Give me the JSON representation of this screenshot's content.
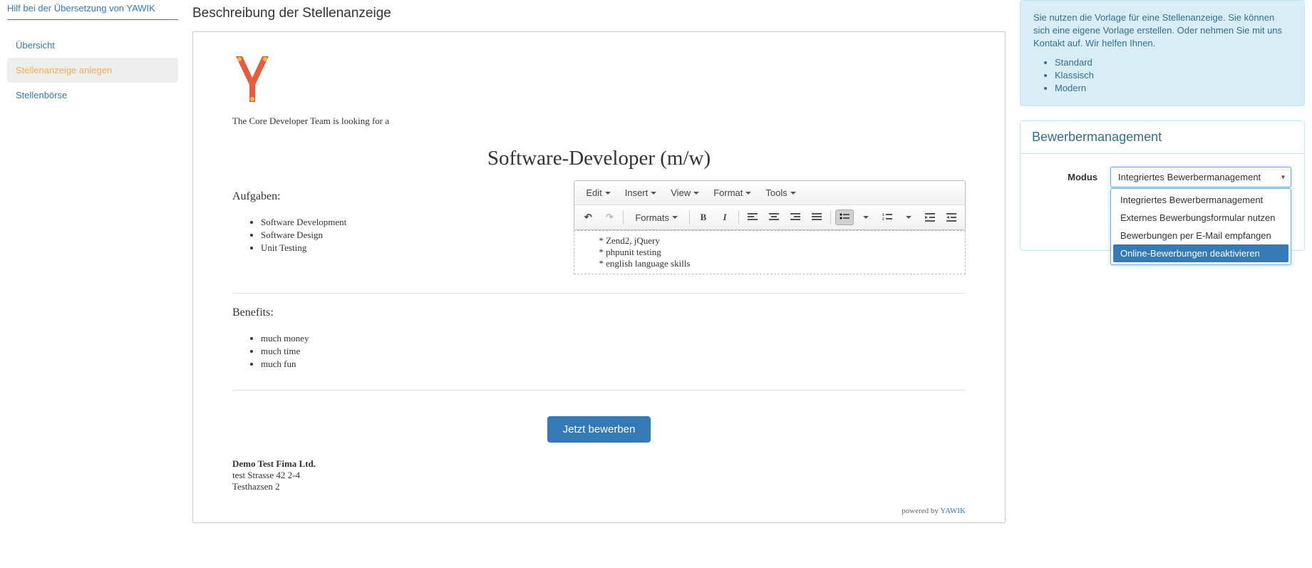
{
  "sidebar": {
    "help_link": "Hilf bei der Übersetzung von YAWIK",
    "items": [
      {
        "label": "Übersicht",
        "active": false
      },
      {
        "label": "Stellenanzeige anlegen",
        "active": true
      },
      {
        "label": "Stellenbörse",
        "active": false
      }
    ]
  },
  "main": {
    "section_title": "Beschreibung der Stellenanzeige",
    "intro": "The Core Developer Team is looking for a",
    "job_title": "Software-Developer (m/w)",
    "tasks_heading": "Aufgaben:",
    "tasks": [
      "Software Development",
      "Software Design",
      "Unit Testing"
    ],
    "skills": [
      "Zend2, jQuery",
      "phpunit testing",
      "english language skills"
    ],
    "benefits_heading": "Benefits:",
    "benefits": [
      "much money",
      "much time",
      "much fun"
    ],
    "apply_label": "Jetzt bewerben",
    "company": {
      "name": "Demo Test Fima Ltd.",
      "line1": "test Strasse 42 2-4",
      "line2": "Testhazsen 2"
    },
    "powered_prefix": "powered by ",
    "powered_link": "YAWIK"
  },
  "editor": {
    "menus": [
      "Edit",
      "Insert",
      "View",
      "Format",
      "Tools"
    ],
    "formats_label": "Formats"
  },
  "right": {
    "info_text": "Sie nutzen die Vorlage für eine Stellenanzeige. Sie können sich eine eigene Vorlage erstellen. Oder nehmen Sie mit uns Kontakt auf. Wir helfen Ihnen.",
    "templates": [
      "Standard",
      "Klassisch",
      "Modern"
    ],
    "panel_title": "Bewerbermanagement",
    "modus_label": "Modus",
    "select_value": "Integriertes Bewerbermanagement",
    "options": [
      {
        "label": "Integriertes Bewerbermanagement",
        "highlight": false
      },
      {
        "label": "Externes Bewerbungsformular nutzen",
        "highlight": false
      },
      {
        "label": "Bewerbungen per E-Mail empfangen",
        "highlight": false
      },
      {
        "label": "Online-Bewerbungen deaktivieren",
        "highlight": true
      }
    ]
  }
}
